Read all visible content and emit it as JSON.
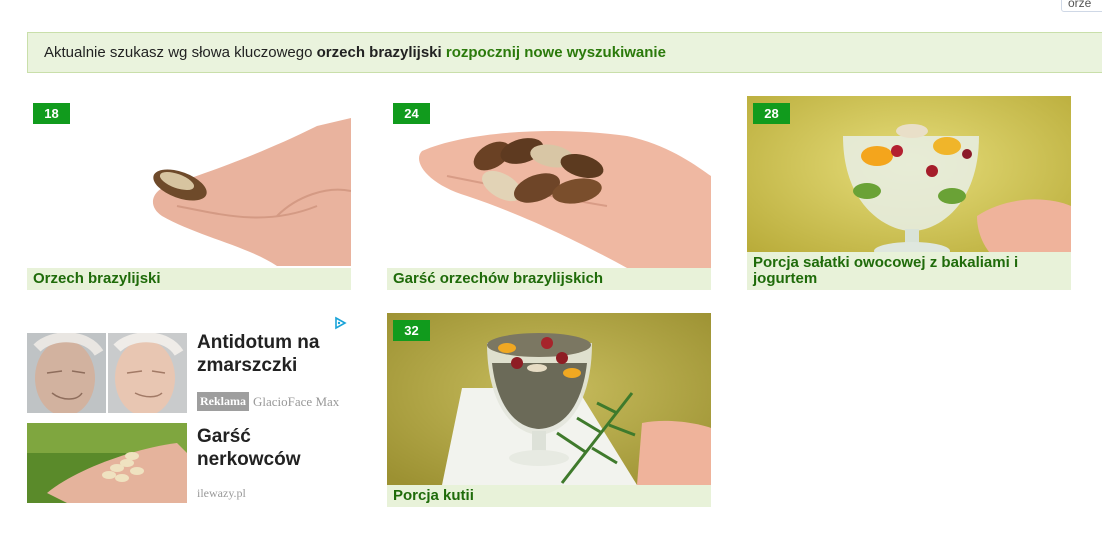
{
  "corner_text": "orze",
  "search": {
    "prefix": "Aktualnie szukasz wg słowa kluczowego",
    "keyword": "orzech brazylijski",
    "new_search_link": "rozpocznij nowe wyszukiwanie"
  },
  "cards": [
    {
      "badge": "18",
      "caption": "Orzech brazylijski",
      "image": "hand-holding-brazil-nut"
    },
    {
      "badge": "24",
      "caption": "Garść orzechów brazylijskich",
      "image": "hand-holding-brazil-nuts"
    },
    {
      "badge": "28",
      "caption": "Porcja sałatki owocowej z bakaliami i jogurtem",
      "image": "fruit-salad-glass"
    },
    {
      "badge": "32",
      "caption": "Porcja kutii",
      "image": "kutia-glass"
    }
  ],
  "ad": {
    "title1": "Antidotum na zmarszczki",
    "reklama": "Reklama",
    "sponsor": "GlacioFace Max",
    "title2": "Garść nerkowców",
    "site": "ilewazy.pl",
    "icon": "adchoices-icon"
  },
  "colors": {
    "accent_green": "#119b1d",
    "link_green": "#2b7a0b",
    "caption_bg": "#e8f2d9",
    "search_bg": "#eaf3dd"
  }
}
